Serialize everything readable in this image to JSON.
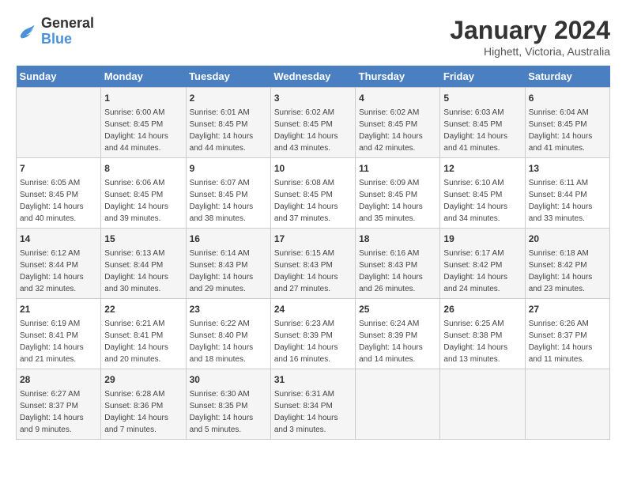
{
  "logo": {
    "line1": "General",
    "line2": "Blue"
  },
  "title": "January 2024",
  "location": "Highett, Victoria, Australia",
  "days_header": [
    "Sunday",
    "Monday",
    "Tuesday",
    "Wednesday",
    "Thursday",
    "Friday",
    "Saturday"
  ],
  "weeks": [
    [
      {
        "day": "",
        "info": ""
      },
      {
        "day": "1",
        "info": "Sunrise: 6:00 AM\nSunset: 8:45 PM\nDaylight: 14 hours\nand 44 minutes."
      },
      {
        "day": "2",
        "info": "Sunrise: 6:01 AM\nSunset: 8:45 PM\nDaylight: 14 hours\nand 44 minutes."
      },
      {
        "day": "3",
        "info": "Sunrise: 6:02 AM\nSunset: 8:45 PM\nDaylight: 14 hours\nand 43 minutes."
      },
      {
        "day": "4",
        "info": "Sunrise: 6:02 AM\nSunset: 8:45 PM\nDaylight: 14 hours\nand 42 minutes."
      },
      {
        "day": "5",
        "info": "Sunrise: 6:03 AM\nSunset: 8:45 PM\nDaylight: 14 hours\nand 41 minutes."
      },
      {
        "day": "6",
        "info": "Sunrise: 6:04 AM\nSunset: 8:45 PM\nDaylight: 14 hours\nand 41 minutes."
      }
    ],
    [
      {
        "day": "7",
        "info": "Sunrise: 6:05 AM\nSunset: 8:45 PM\nDaylight: 14 hours\nand 40 minutes."
      },
      {
        "day": "8",
        "info": "Sunrise: 6:06 AM\nSunset: 8:45 PM\nDaylight: 14 hours\nand 39 minutes."
      },
      {
        "day": "9",
        "info": "Sunrise: 6:07 AM\nSunset: 8:45 PM\nDaylight: 14 hours\nand 38 minutes."
      },
      {
        "day": "10",
        "info": "Sunrise: 6:08 AM\nSunset: 8:45 PM\nDaylight: 14 hours\nand 37 minutes."
      },
      {
        "day": "11",
        "info": "Sunrise: 6:09 AM\nSunset: 8:45 PM\nDaylight: 14 hours\nand 35 minutes."
      },
      {
        "day": "12",
        "info": "Sunrise: 6:10 AM\nSunset: 8:45 PM\nDaylight: 14 hours\nand 34 minutes."
      },
      {
        "day": "13",
        "info": "Sunrise: 6:11 AM\nSunset: 8:44 PM\nDaylight: 14 hours\nand 33 minutes."
      }
    ],
    [
      {
        "day": "14",
        "info": "Sunrise: 6:12 AM\nSunset: 8:44 PM\nDaylight: 14 hours\nand 32 minutes."
      },
      {
        "day": "15",
        "info": "Sunrise: 6:13 AM\nSunset: 8:44 PM\nDaylight: 14 hours\nand 30 minutes."
      },
      {
        "day": "16",
        "info": "Sunrise: 6:14 AM\nSunset: 8:43 PM\nDaylight: 14 hours\nand 29 minutes."
      },
      {
        "day": "17",
        "info": "Sunrise: 6:15 AM\nSunset: 8:43 PM\nDaylight: 14 hours\nand 27 minutes."
      },
      {
        "day": "18",
        "info": "Sunrise: 6:16 AM\nSunset: 8:43 PM\nDaylight: 14 hours\nand 26 minutes."
      },
      {
        "day": "19",
        "info": "Sunrise: 6:17 AM\nSunset: 8:42 PM\nDaylight: 14 hours\nand 24 minutes."
      },
      {
        "day": "20",
        "info": "Sunrise: 6:18 AM\nSunset: 8:42 PM\nDaylight: 14 hours\nand 23 minutes."
      }
    ],
    [
      {
        "day": "21",
        "info": "Sunrise: 6:19 AM\nSunset: 8:41 PM\nDaylight: 14 hours\nand 21 minutes."
      },
      {
        "day": "22",
        "info": "Sunrise: 6:21 AM\nSunset: 8:41 PM\nDaylight: 14 hours\nand 20 minutes."
      },
      {
        "day": "23",
        "info": "Sunrise: 6:22 AM\nSunset: 8:40 PM\nDaylight: 14 hours\nand 18 minutes."
      },
      {
        "day": "24",
        "info": "Sunrise: 6:23 AM\nSunset: 8:39 PM\nDaylight: 14 hours\nand 16 minutes."
      },
      {
        "day": "25",
        "info": "Sunrise: 6:24 AM\nSunset: 8:39 PM\nDaylight: 14 hours\nand 14 minutes."
      },
      {
        "day": "26",
        "info": "Sunrise: 6:25 AM\nSunset: 8:38 PM\nDaylight: 14 hours\nand 13 minutes."
      },
      {
        "day": "27",
        "info": "Sunrise: 6:26 AM\nSunset: 8:37 PM\nDaylight: 14 hours\nand 11 minutes."
      }
    ],
    [
      {
        "day": "28",
        "info": "Sunrise: 6:27 AM\nSunset: 8:37 PM\nDaylight: 14 hours\nand 9 minutes."
      },
      {
        "day": "29",
        "info": "Sunrise: 6:28 AM\nSunset: 8:36 PM\nDaylight: 14 hours\nand 7 minutes."
      },
      {
        "day": "30",
        "info": "Sunrise: 6:30 AM\nSunset: 8:35 PM\nDaylight: 14 hours\nand 5 minutes."
      },
      {
        "day": "31",
        "info": "Sunrise: 6:31 AM\nSunset: 8:34 PM\nDaylight: 14 hours\nand 3 minutes."
      },
      {
        "day": "",
        "info": ""
      },
      {
        "day": "",
        "info": ""
      },
      {
        "day": "",
        "info": ""
      }
    ]
  ]
}
